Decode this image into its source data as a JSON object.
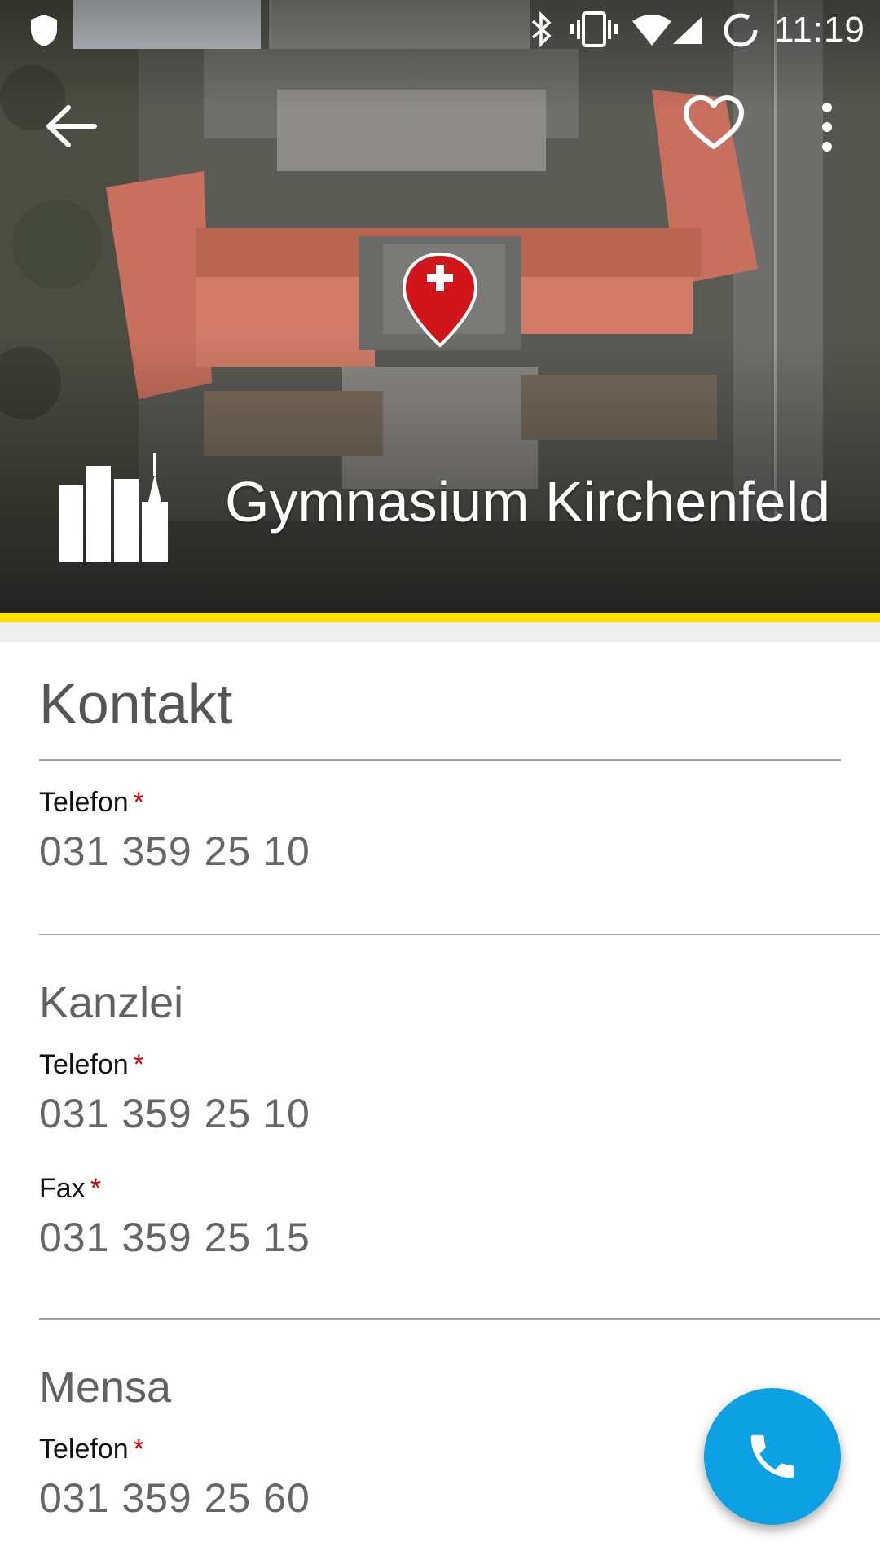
{
  "status_bar": {
    "time": "11:19",
    "icons": [
      "shield-icon",
      "bluetooth-icon",
      "vibrate-icon",
      "wifi-icon",
      "cell-signal-icon",
      "sync-icon"
    ]
  },
  "toolbar": {
    "back_icon": "arrow-back-icon",
    "favorite_icon": "heart-outline-icon",
    "more_icon": "more-vert-icon"
  },
  "header": {
    "title": "Gymnasium Kirchenfeld",
    "icon": "city-buildings-icon",
    "map_marker_icon": "swiss-pin-icon"
  },
  "colors": {
    "accent_yellow": "#ffe000",
    "fab_blue": "#0ba1e2",
    "required_red": "#d50000"
  },
  "contact": {
    "title": "Kontakt",
    "phone_label": "Telefon",
    "phone_required": "*",
    "phone_value": "031 359 25 10"
  },
  "kanzlei": {
    "title": "Kanzlei",
    "phone_label": "Telefon",
    "phone_required": "*",
    "phone_value": "031 359 25 10",
    "fax_label": "Fax",
    "fax_required": "*",
    "fax_value": "031 359 25 15"
  },
  "mensa": {
    "title": "Mensa",
    "phone_label": "Telefon",
    "phone_required": "*",
    "phone_value": "031 359 25 60"
  },
  "fab": {
    "icon": "phone-icon"
  }
}
